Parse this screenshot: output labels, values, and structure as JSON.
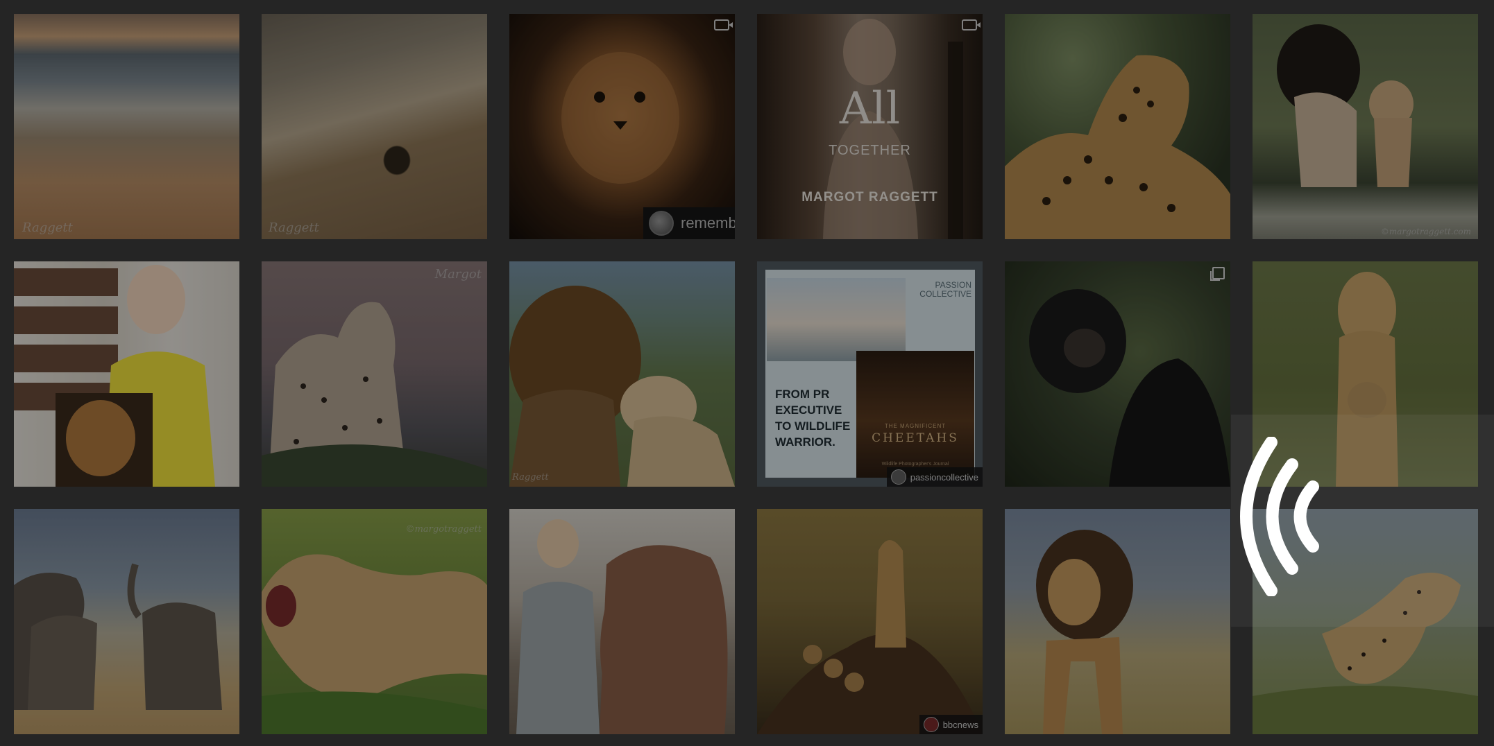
{
  "tiles": {
    "t3": {
      "repost_handle": "rememb"
    },
    "t4": {
      "title_line1": "All",
      "title_line2": "TOGETHER",
      "name": "MARGOT RAGGETT"
    },
    "t6": {
      "watermark": "©margotraggett.com"
    },
    "t7": {
      "watermark": "Margot"
    },
    "t9": {
      "watermark": "Raggett"
    },
    "t10": {
      "brand_line1": "PASSION",
      "brand_line2": "COLLECTIVE",
      "headline_1": "FROM PR",
      "headline_2": "EXECUTIVE",
      "headline_3": "TO WILDLIFE",
      "headline_4": "WARRIOR.",
      "book_line1": "THE MAGNIFICENT",
      "book_title": "CHEETAHS",
      "book_sub": "Wildlife Photographer's Journal",
      "handle": "passioncollective"
    },
    "t14": {
      "watermark": "©margotraggett"
    },
    "t16": {
      "handle": "bbcnews"
    }
  },
  "colors": {
    "overlay": "#000000",
    "background": "#3c3c3c",
    "loader": "#ffffff"
  },
  "icons": [
    "video-icon",
    "multi-image-icon",
    "loading-arcs-icon"
  ]
}
